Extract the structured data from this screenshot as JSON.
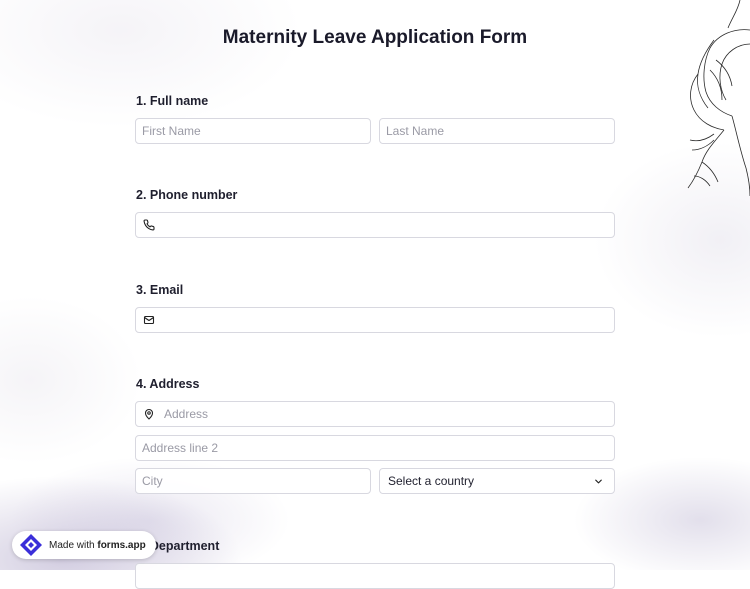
{
  "form": {
    "title": "Maternity Leave Application Form"
  },
  "questions": {
    "full_name": {
      "label": "1.  Full name",
      "first_placeholder": "First Name",
      "last_placeholder": "Last Name"
    },
    "phone": {
      "label": "2. Phone number",
      "icon": "phone-icon"
    },
    "email": {
      "label": "3. Email",
      "icon": "mail-icon"
    },
    "address": {
      "label": "4. Address",
      "icon": "location-pin-icon",
      "address_placeholder": "Address",
      "line2_placeholder": "Address line 2",
      "city_placeholder": "City",
      "country_value": "Select a country"
    },
    "department": {
      "label": "5. Department"
    }
  },
  "badge": {
    "prefix": "Made with",
    "brand": "forms.app"
  },
  "colors": {
    "brand_purple": "#4a3aff",
    "field_border": "#d8d8e0",
    "placeholder": "#9a9aa5",
    "wash": "#8273aa"
  }
}
